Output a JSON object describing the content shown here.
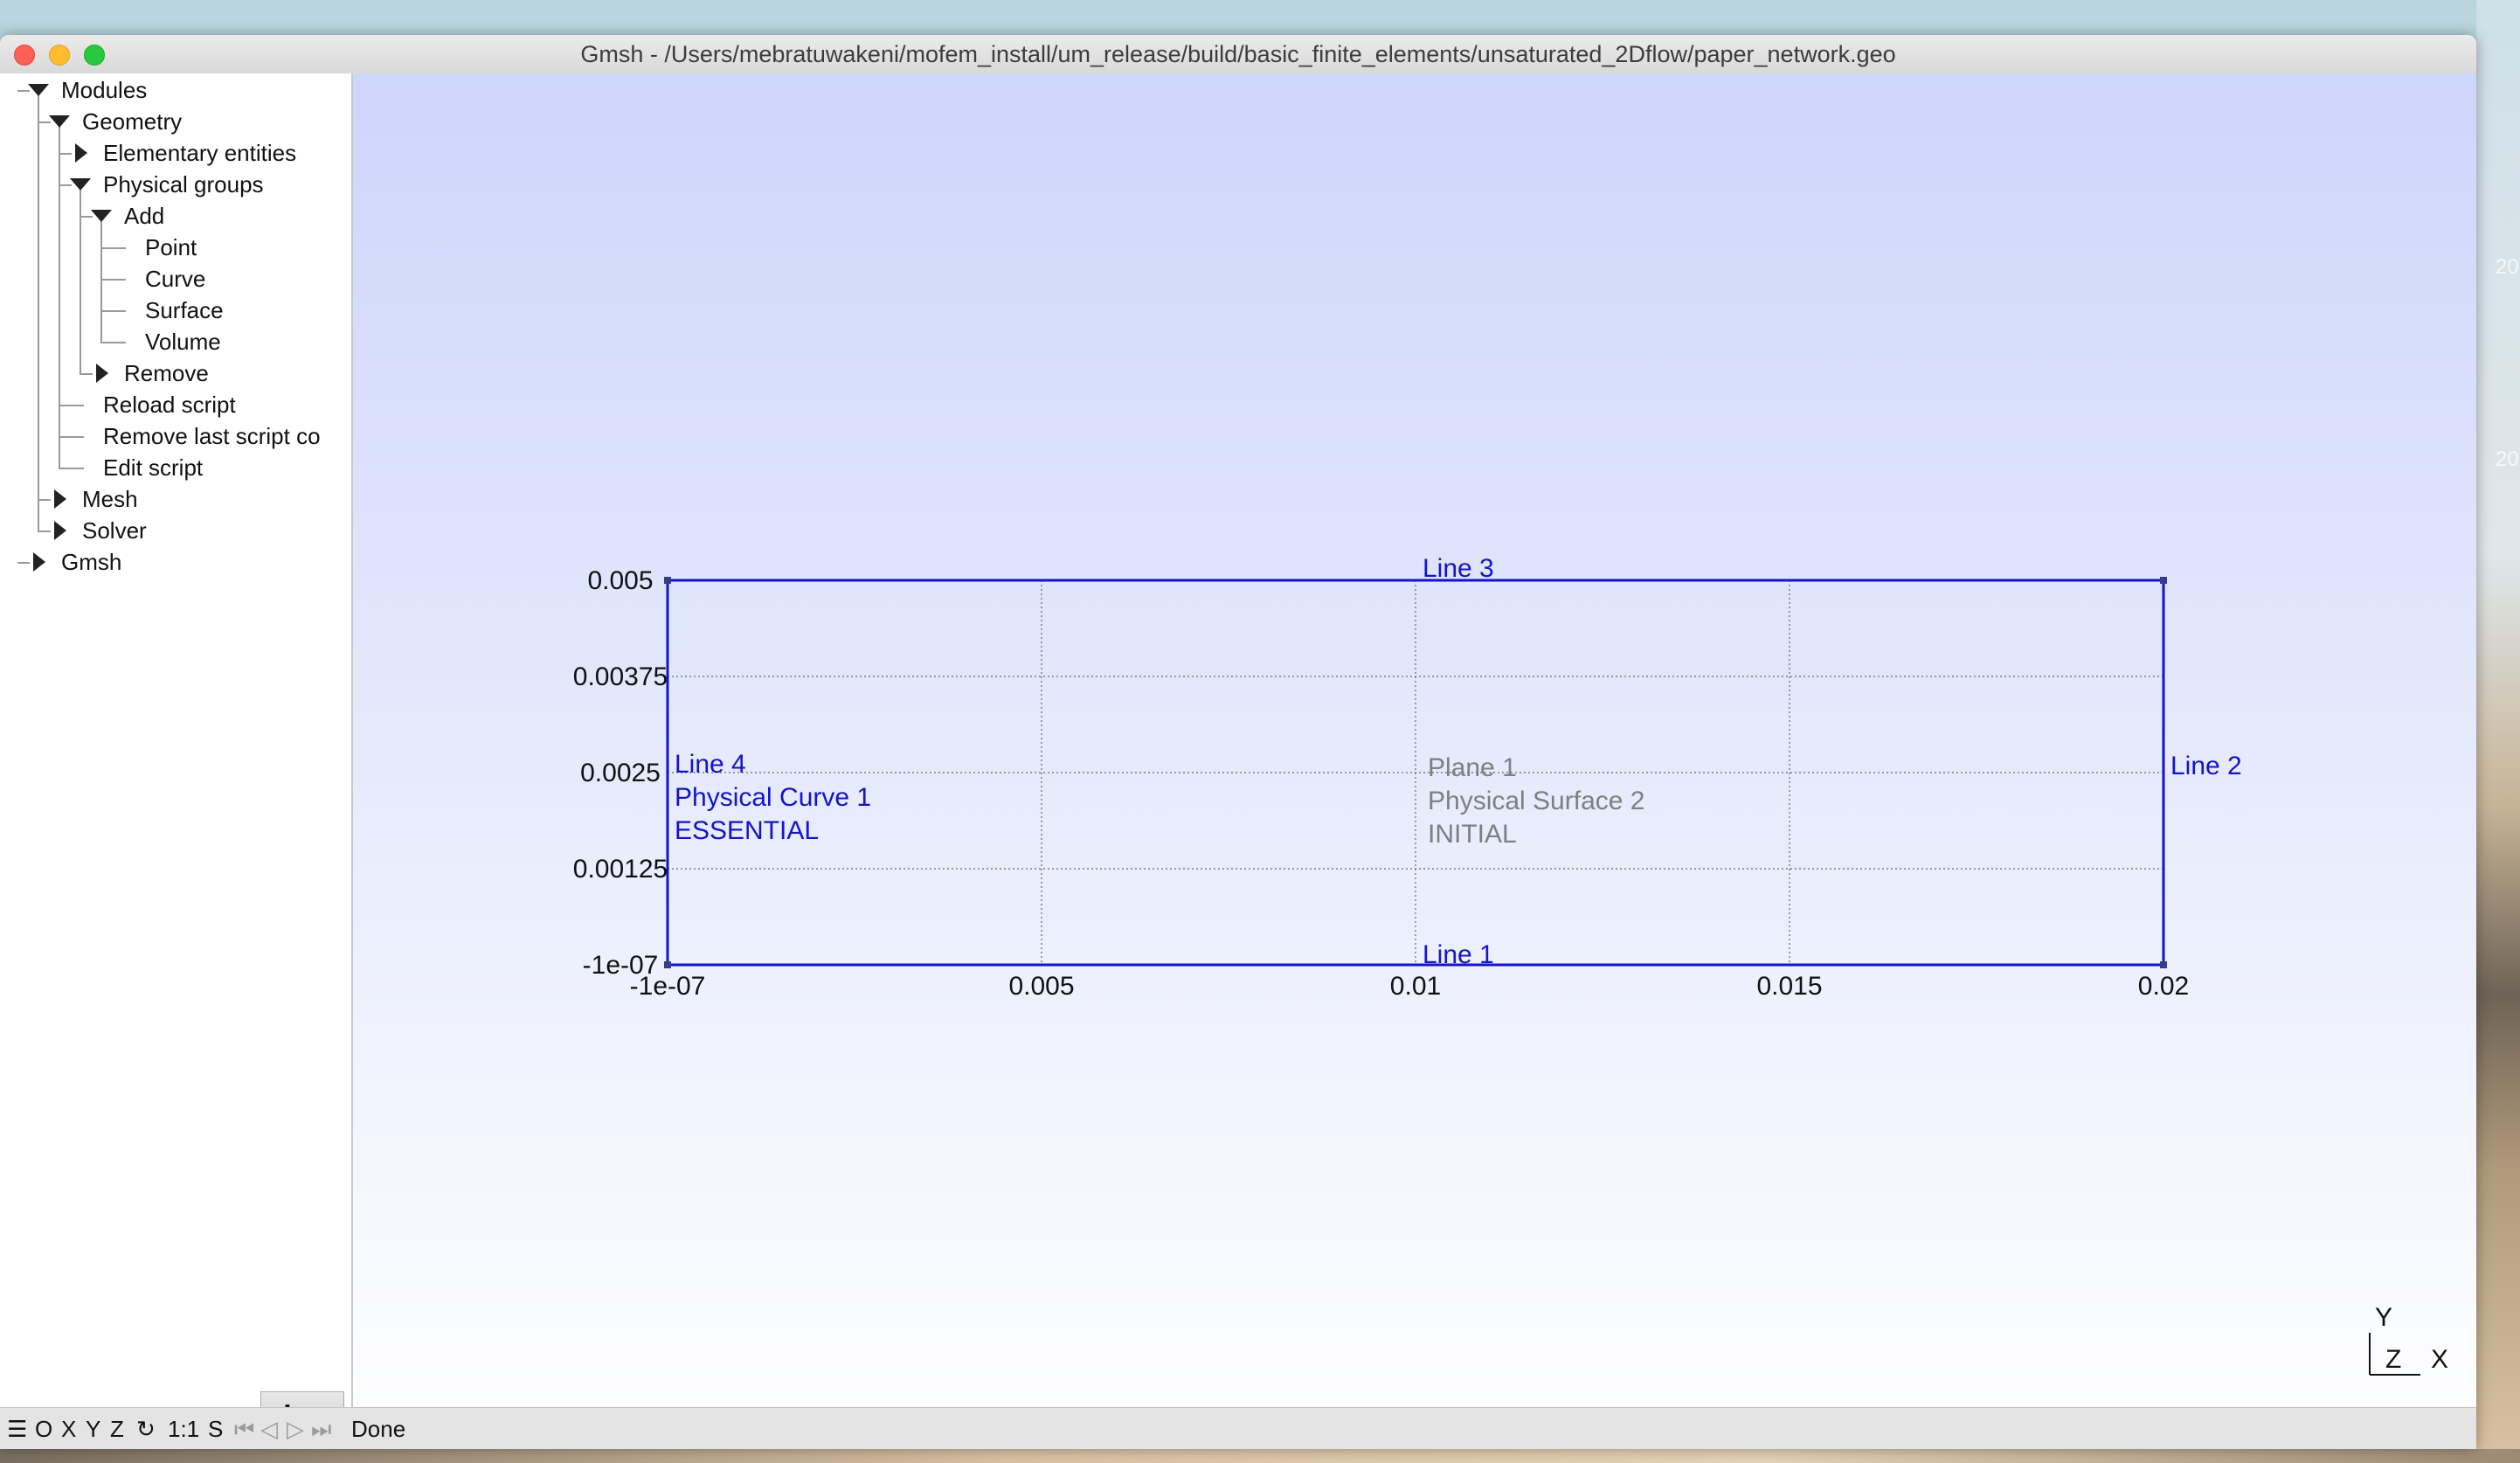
{
  "window": {
    "title": "Gmsh - /Users/mebratuwakeni/mofem_install/um_release/build/basic_finite_elements/unsaturated_2Dflow/paper_network.geo"
  },
  "tree": [
    {
      "label": "Modules",
      "level": 0,
      "toggle": "open"
    },
    {
      "label": "Geometry",
      "level": 1,
      "toggle": "open"
    },
    {
      "label": "Elementary entities",
      "level": 2,
      "toggle": "closed"
    },
    {
      "label": "Physical groups",
      "level": 2,
      "toggle": "open"
    },
    {
      "label": "Add",
      "level": 3,
      "toggle": "open"
    },
    {
      "label": "Point",
      "level": 4,
      "toggle": "none"
    },
    {
      "label": "Curve",
      "level": 4,
      "toggle": "none"
    },
    {
      "label": "Surface",
      "level": 4,
      "toggle": "none"
    },
    {
      "label": "Volume",
      "level": 4,
      "toggle": "none"
    },
    {
      "label": "Remove",
      "level": 3,
      "toggle": "closed"
    },
    {
      "label": "Reload script",
      "level": 2,
      "toggle": "none"
    },
    {
      "label": "Remove last script co",
      "level": 2,
      "toggle": "none"
    },
    {
      "label": "Edit script",
      "level": 2,
      "toggle": "none"
    },
    {
      "label": "Mesh",
      "level": 1,
      "toggle": "closed"
    },
    {
      "label": "Solver",
      "level": 1,
      "toggle": "closed"
    },
    {
      "label": "Gmsh",
      "level": 0,
      "toggle": "closed"
    }
  ],
  "sidebar": {
    "gear_icon": "gear-icon",
    "filter_icon": "filter-icon"
  },
  "statusbar": {
    "items": [
      "O",
      "X",
      "Y",
      "Z",
      "1:1",
      "S"
    ],
    "status_text": "Done"
  },
  "viewport": {
    "x_ticks": [
      "-1e-07",
      "0.005",
      "0.01",
      "0.015",
      "0.02"
    ],
    "y_ticks": [
      "0.005",
      "0.00375",
      "0.0025",
      "0.00125",
      "-1e-07"
    ],
    "x_range": [
      -1e-07,
      0.02
    ],
    "y_range": [
      -1e-07,
      0.005
    ],
    "line_labels": {
      "top": "Line 3",
      "right": "Line 2",
      "bottom": "Line 1",
      "left": "Line 4"
    },
    "left_group": [
      "Physical Curve 1",
      "ESSENTIAL"
    ],
    "plane_labels": [
      "Plane 1",
      "Physical Surface 2",
      "INITIAL"
    ],
    "axes_triad": {
      "y": "Y",
      "z": "Z",
      "x": "X"
    },
    "colors": {
      "curves": "#1414c8",
      "surface_labels": "#7f7f7f"
    }
  },
  "desktop_labels": [
    "20",
    "20"
  ]
}
